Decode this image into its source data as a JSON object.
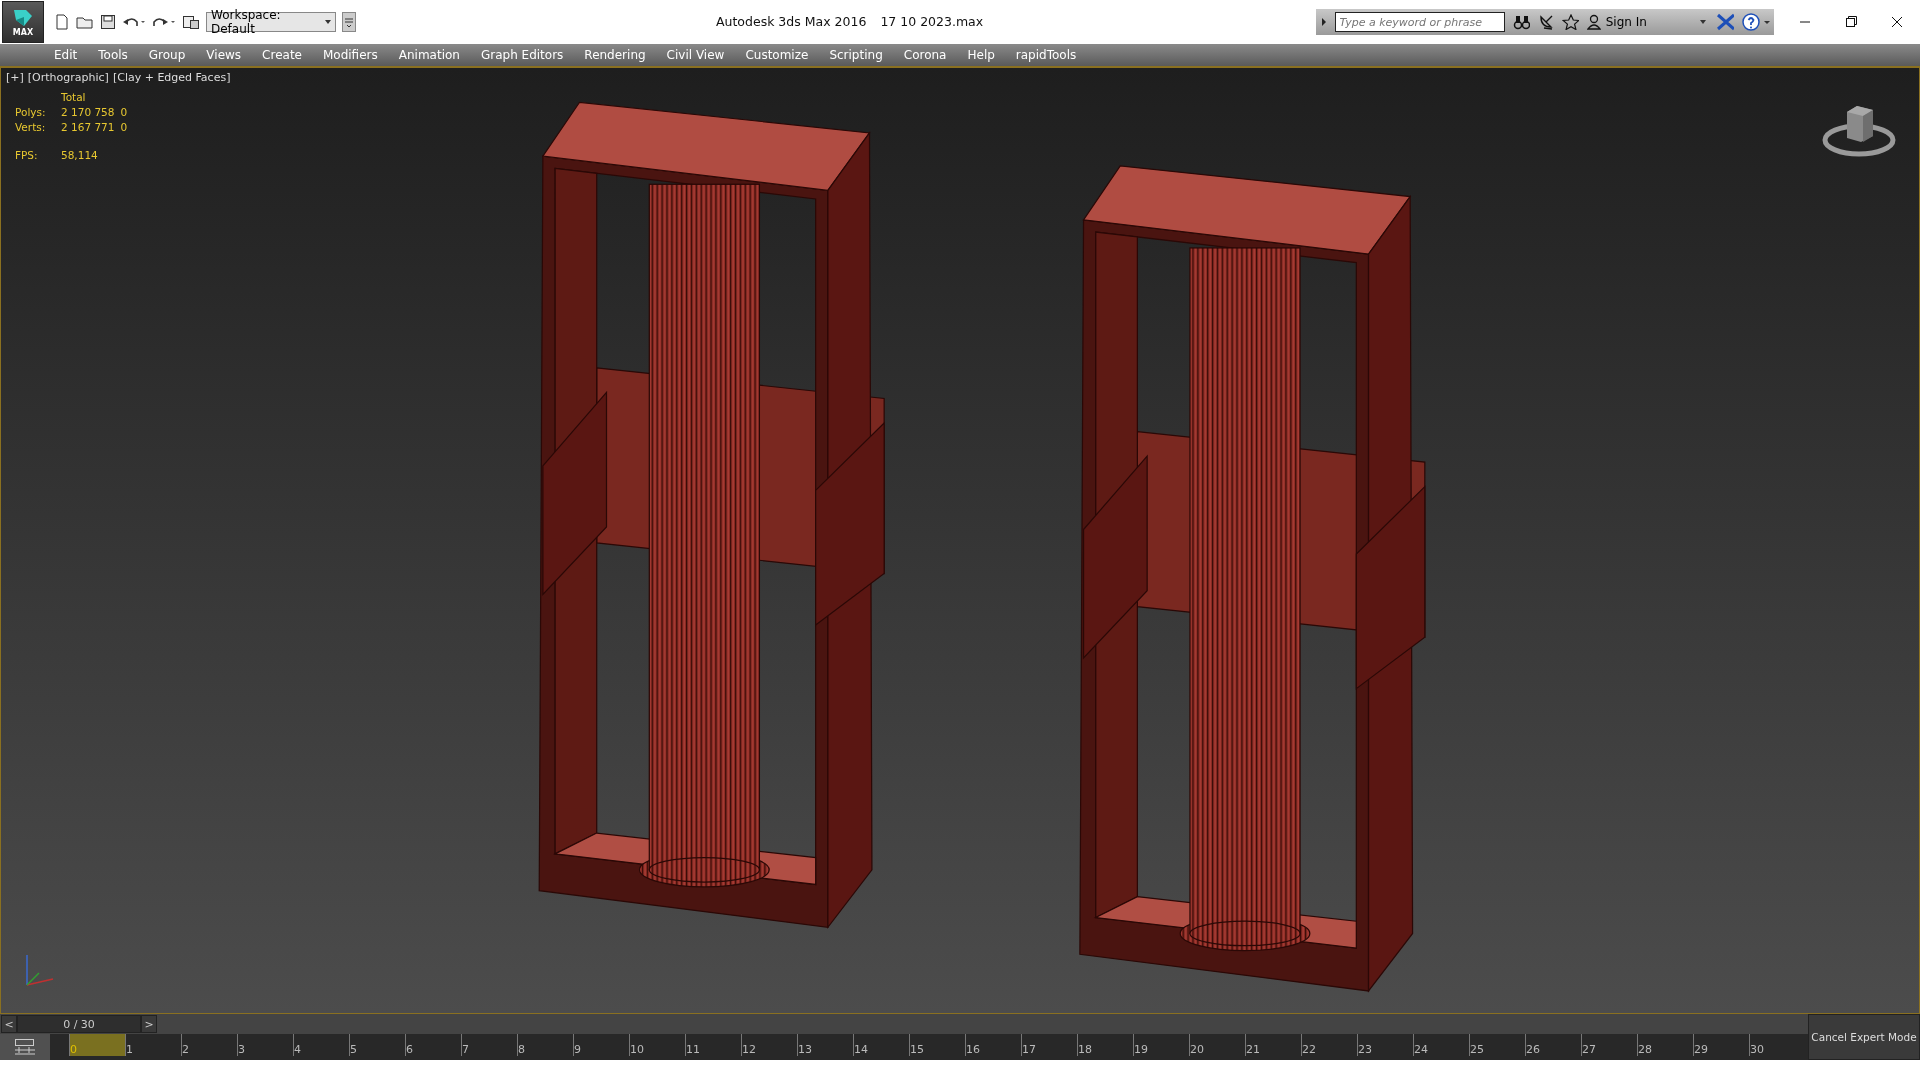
{
  "app_button": {
    "label": "MAX"
  },
  "workspace": {
    "label": "Workspace: Default"
  },
  "window": {
    "title": "Autodesk 3ds Max 2016",
    "file": "17 10 2023.max"
  },
  "search": {
    "placeholder": "Type a keyword or phrase"
  },
  "sign_in": {
    "label": "Sign In"
  },
  "menu": [
    "Edit",
    "Tools",
    "Group",
    "Views",
    "Create",
    "Modifiers",
    "Animation",
    "Graph Editors",
    "Rendering",
    "Civil View",
    "Customize",
    "Scripting",
    "Corona",
    "Help",
    "rapidTools"
  ],
  "viewport": {
    "labels": [
      "[+]",
      "[Orthographic]",
      "[Clay + Edged Faces]"
    ],
    "stats": {
      "header": "Total",
      "rows": [
        {
          "name": "Polys:",
          "value": "2 170 758",
          "selected_value": "0"
        },
        {
          "name": "Verts:",
          "value": "2 167 771",
          "selected_value": "0"
        }
      ],
      "fps_label": "FPS:",
      "fps": "58,114"
    }
  },
  "time_slider": {
    "prev": "<",
    "frame": "0 / 30",
    "next": ">"
  },
  "trackbar": {
    "ticks": [
      {
        "label": "0",
        "selected": true
      },
      {
        "label": "1",
        "selected": false
      },
      {
        "label": "2",
        "selected": false
      },
      {
        "label": "3",
        "selected": false
      },
      {
        "label": "4",
        "selected": false
      },
      {
        "label": "5",
        "selected": false
      },
      {
        "label": "6",
        "selected": false
      },
      {
        "label": "7",
        "selected": false
      },
      {
        "label": "8",
        "selected": false
      },
      {
        "label": "9",
        "selected": false
      },
      {
        "label": "10",
        "selected": false
      },
      {
        "label": "11",
        "selected": false
      },
      {
        "label": "12",
        "selected": false
      },
      {
        "label": "13",
        "selected": false
      },
      {
        "label": "14",
        "selected": false
      },
      {
        "label": "15",
        "selected": false
      },
      {
        "label": "16",
        "selected": false
      },
      {
        "label": "17",
        "selected": false
      },
      {
        "label": "18",
        "selected": false
      },
      {
        "label": "19",
        "selected": false
      },
      {
        "label": "20",
        "selected": false
      },
      {
        "label": "21",
        "selected": false
      },
      {
        "label": "22",
        "selected": false
      },
      {
        "label": "23",
        "selected": false
      },
      {
        "label": "24",
        "selected": false
      },
      {
        "label": "25",
        "selected": false
      },
      {
        "label": "26",
        "selected": false
      },
      {
        "label": "27",
        "selected": false
      },
      {
        "label": "28",
        "selected": false
      },
      {
        "label": "29",
        "selected": false
      },
      {
        "label": "30",
        "selected": false
      }
    ]
  },
  "expert_mode": {
    "label": "Cancel Expert Mode"
  }
}
